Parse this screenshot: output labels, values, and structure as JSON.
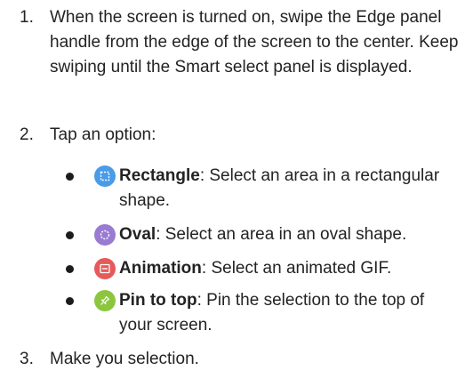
{
  "steps": [
    {
      "number": "1.",
      "text": "When the screen is turned on, swipe the Edge panel handle from the edge of the screen to the center. Keep swiping until the Smart select panel is displayed."
    },
    {
      "number": "2.",
      "text": "Tap an option:"
    },
    {
      "number": "3.",
      "text": "Make you selection."
    }
  ],
  "options": [
    {
      "name": "Rectangle",
      "desc": ": Select an area in a rectangular shape.",
      "icon": "rectangle-select-icon",
      "color": "#4a9be8"
    },
    {
      "name": "Oval",
      "desc": ": Select an area in an oval shape.",
      "icon": "oval-select-icon",
      "color": "#9a7bd2"
    },
    {
      "name": "Animation",
      "desc": ": Select an animated GIF.",
      "icon": "gif-animation-icon",
      "color": "#e65a5a"
    },
    {
      "name": "Pin to top",
      "desc": ": Pin the selection to the top of your screen.",
      "icon": "pin-icon",
      "color": "#8cc63f"
    }
  ]
}
